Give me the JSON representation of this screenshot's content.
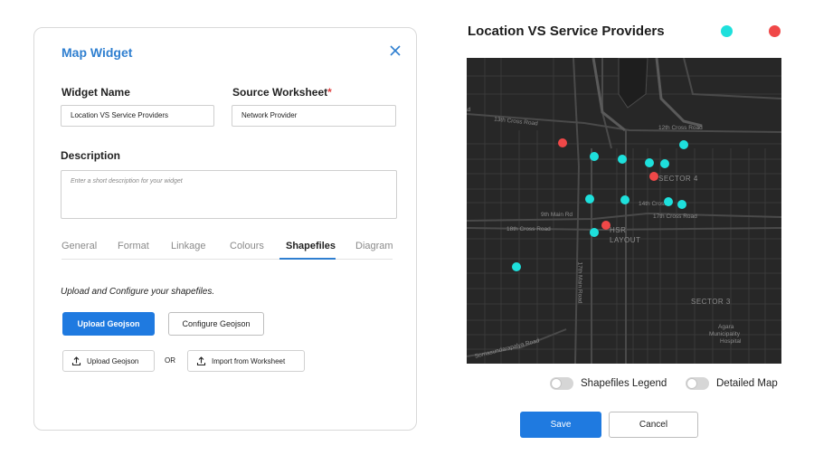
{
  "widget": {
    "title": "Map Widget",
    "close_icon": "close-icon",
    "widget_name_label": "Widget Name",
    "widget_name_value": "Location VS Service Providers",
    "source_worksheet_label": "Source Worksheet",
    "required_mark": "*",
    "source_worksheet_value": "Network Provider",
    "description_label": "Description",
    "description_placeholder": "Enter a short description for your widget",
    "tabs": [
      {
        "label": "General",
        "active": false
      },
      {
        "label": "Format",
        "active": false
      },
      {
        "label": "Linkage",
        "active": false
      },
      {
        "label": "Colours",
        "active": false
      },
      {
        "label": "Shapefiles",
        "active": true
      },
      {
        "label": "Diagram",
        "active": false
      }
    ],
    "instruction": "Upload and Configure your shapefiles.",
    "upload_geojson_primary": "Upload Geojson",
    "configure_geojson": "Configure Geojson",
    "upload_geojson_small": "Upload Geojson",
    "or_text": "OR",
    "import_from_worksheet": "Import from Worksheet",
    "upload_icon": "upload-icon"
  },
  "map_panel": {
    "title": "Location VS Service Providers",
    "legend_colors": [
      "#1ee0dc",
      "#f04848"
    ],
    "map_labels": [
      "13th Cross Road",
      "12th Cross Road",
      "SECTOR 4",
      "14th Cross",
      "17th Cross Road",
      "9th Main Rd",
      "18th Cross Road",
      "HSR",
      "LAYOUT",
      "17th Main Road",
      "SECTOR 3",
      "Somasundarapalya Road",
      "Agara",
      "Municipality",
      "Hospital",
      "ad"
    ],
    "markers": {
      "cyan": "#1ee0dc",
      "red": "#f04848"
    },
    "shapefiles_legend_label": "Shapefiles Legend",
    "detailed_map_label": "Detailed Map",
    "shapefiles_legend_on": false,
    "detailed_map_on": false,
    "save_label": "Save",
    "cancel_label": "Cancel"
  }
}
